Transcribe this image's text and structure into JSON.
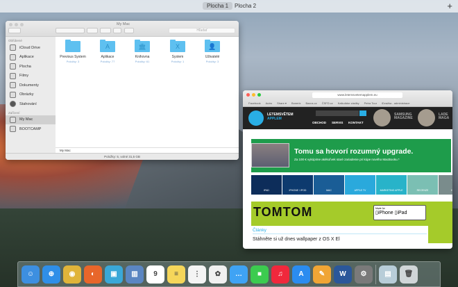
{
  "spaces": {
    "items": [
      "Plocha 1",
      "Plocha 2"
    ],
    "active": 0,
    "add": "+"
  },
  "finder": {
    "title": "My Mac",
    "search_placeholder": "Hľadať",
    "sidebar": {
      "favorites_header": "Obľúbené",
      "favorites": [
        "iCloud Drive",
        "Aplikace",
        "Plocha",
        "Filmy",
        "Dokumenty",
        "Obrázky",
        "Stahování"
      ],
      "devices_header": "Zařízení",
      "devices": [
        "My Mac",
        "BOOTCAMP"
      ],
      "selected": "My Mac"
    },
    "folders": [
      {
        "name": "Previous System",
        "sub": "Položky: 3",
        "glyph": ""
      },
      {
        "name": "Aplikace",
        "sub": "Položky: 77",
        "glyph": "A"
      },
      {
        "name": "Knihovna",
        "sub": "Položky: 61",
        "glyph": "🏛"
      },
      {
        "name": "System",
        "sub": "Položky: 1",
        "glyph": "X"
      },
      {
        "name": "Uživatelé",
        "sub": "Položky: 3",
        "glyph": "👤"
      }
    ],
    "path": "My Mac",
    "status": "Položky: 5, volné 31,5 GB"
  },
  "safari": {
    "url": "www.letemsvetemapplem.eu",
    "bookmarks": [
      "Facebook",
      "Autro",
      "Share ▾",
      "Bonerix",
      "Bazos.cz",
      "ČSFD.cz",
      "Kalkulátor zásilky",
      "Petra Tour",
      "iDvažka - administrace"
    ],
    "site": {
      "brand1": "LETEM",
      "brand2": "SVĚTEM",
      "brand3": "APPLEM",
      "nav": [
        "OBCHOD",
        "SERVIS",
        "KONTAKT"
      ],
      "mag1": [
        "SAMSUNG",
        "MAGAZINE"
      ],
      "mag2": [
        "LADE",
        "MAGA"
      ],
      "ad_headline": "Tomu sa hovorí rozumný upgrade.",
      "ad_sub": "Za 100 € vykúpime akékoľvek staré zariadenie pri kúpe nového MacBooku.*",
      "categories": [
        {
          "label": "IPAD",
          "color": "#0d2d5a"
        },
        {
          "label": "IPHONE / IPOD",
          "color": "#0d3a6e"
        },
        {
          "label": "MAC",
          "color": "#1a5d96"
        },
        {
          "label": "APPLE TV",
          "color": "#2aa9dc"
        },
        {
          "label": "MARKETING APPLE",
          "color": "#28b3c9"
        },
        {
          "label": "RECENZE",
          "color": "#7bbfb3"
        },
        {
          "label": "HIST",
          "color": "#7a8c8c"
        }
      ],
      "tomtom": "TOMTOM",
      "made_for": "Made for",
      "made_devices": "▯iPhone ▯iPad",
      "articles_title": "Články",
      "article_headline": "Stáhněte si už dnes wallpaper z OS X El"
    }
  },
  "dock": [
    {
      "name": "finder",
      "color": "#3d8fe0",
      "g": "☺"
    },
    {
      "name": "safari",
      "color": "#2f8fe8",
      "g": "⊕"
    },
    {
      "name": "chrome",
      "color": "#e0b43a",
      "g": "◉"
    },
    {
      "name": "firefox",
      "color": "#e8662a",
      "g": "◐"
    },
    {
      "name": "app",
      "color": "#3aa8d8",
      "g": "▣"
    },
    {
      "name": "preview",
      "color": "#5b86c2",
      "g": "▥"
    },
    {
      "name": "calendar",
      "color": "#ffffff",
      "g": "9"
    },
    {
      "name": "notes",
      "color": "#f5d65a",
      "g": "≡"
    },
    {
      "name": "reminders",
      "color": "#f4f4f4",
      "g": "⋮"
    },
    {
      "name": "photos",
      "color": "#f0f0f0",
      "g": "✿"
    },
    {
      "name": "messages",
      "color": "#3fa3f4",
      "g": "…"
    },
    {
      "name": "facetime",
      "color": "#3ccb4f",
      "g": "■"
    },
    {
      "name": "itunes",
      "color": "#f0283c",
      "g": "♫"
    },
    {
      "name": "app-store",
      "color": "#2b8cf0",
      "g": "A"
    },
    {
      "name": "pages",
      "color": "#f0a535",
      "g": "✎"
    },
    {
      "name": "word",
      "color": "#2b579a",
      "g": "W"
    },
    {
      "name": "system-preferences",
      "color": "#7a7a7a",
      "g": "⚙"
    },
    {
      "name": "downloads",
      "color": "#b8cdd8",
      "g": "▤"
    },
    {
      "name": "trash",
      "color": "#d0d6d8",
      "g": "🗑"
    }
  ]
}
